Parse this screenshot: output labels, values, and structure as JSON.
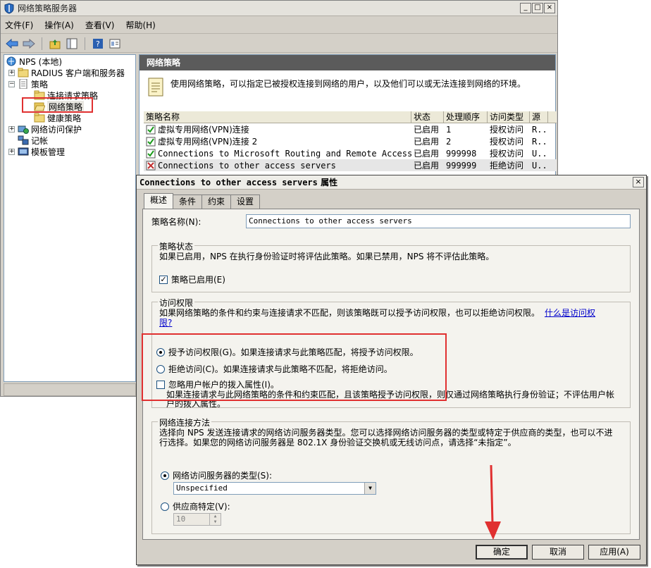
{
  "main_window": {
    "title": "网络策略服务器",
    "window_buttons": [
      "_",
      "□",
      "×"
    ],
    "menu": [
      "文件(F)",
      "操作(A)",
      "查看(V)",
      "帮助(H)"
    ]
  },
  "tree": {
    "items": [
      {
        "label": "NPS (本地)",
        "icon": "server-icon"
      },
      {
        "label": "RADIUS 客户端和服务器",
        "icon": "folder-icon",
        "expander": "+"
      },
      {
        "label": "策略",
        "icon": "document-icon",
        "expander": "−"
      },
      {
        "label": "连接请求策略",
        "icon": "folder-icon"
      },
      {
        "label": "网络策略",
        "icon": "folder-open-icon"
      },
      {
        "label": "健康策略",
        "icon": "folder-icon"
      },
      {
        "label": "网络访问保护",
        "icon": "nap-icon",
        "expander": "+"
      },
      {
        "label": "记帐",
        "icon": "accounting-icon"
      },
      {
        "label": "模板管理",
        "icon": "template-icon",
        "expander": "+"
      }
    ]
  },
  "right_pane": {
    "header": "网络策略",
    "description": "使用网络策略，可以指定已被授权连接到网络的用户，以及他们可以或无法连接到网络的环境。",
    "columns": [
      "策略名称",
      "状态",
      "处理顺序",
      "访问类型",
      "源"
    ],
    "rows": [
      {
        "name": "虚拟专用网络(VPN)连接",
        "state": "已启用",
        "order": "1",
        "type": "授权访问",
        "src": "R.."
      },
      {
        "name": "虚拟专用网络(VPN)连接 2",
        "state": "已启用",
        "order": "2",
        "type": "授权访问",
        "src": "R.."
      },
      {
        "name": "Connections to Microsoft Routing and Remote Access server",
        "state": "已启用",
        "order": "999998",
        "type": "授权访问",
        "src": "U.."
      },
      {
        "name": "Connections to other access servers",
        "state": "已启用",
        "order": "999999",
        "type": "拒绝访问",
        "src": "U.."
      }
    ]
  },
  "dialog": {
    "title_en": "Connections to other access servers",
    "title_cn": "属性",
    "close": "×",
    "tabs": [
      "概述",
      "条件",
      "约束",
      "设置"
    ],
    "policy_name_label": "策略名称(N):",
    "policy_name_value": "Connections to other access servers",
    "state_group": {
      "legend": "策略状态",
      "text": "如果已启用，NPS 在执行身份验证时将评估此策略。如果已禁用，NPS 将不评估此策略。",
      "enabled_label": "策略已启用(E)",
      "enabled_mark": "✓"
    },
    "access_group": {
      "legend": "访问权限",
      "text": "如果网络策略的条件和约束与连接请求不匹配，则该策略既可以授予访问权限，也可以拒绝访问权限。",
      "link_line1": "什么是访问权",
      "link_line2": "限?",
      "grant_label": "授予访问权限(G)。如果连接请求与此策略匹配，将授予访问权限。",
      "deny_label": "拒绝访问(C)。如果连接请求与此策略不匹配，将拒绝访问。",
      "ignore_label": "忽略用户帐户的拨入属性(I)。",
      "ignore_desc_line1": "如果连接请求与此网络策略的条件和约束匹配，且该策略授予访问权限，则仅通过网络策略执行身份验证；不评估用户帐",
      "ignore_desc_line2": "户的拨入属性。"
    },
    "conn_group": {
      "legend": "网络连接方法",
      "text_line1": "选择向 NPS 发送连接请求的网络访问服务器类型。您可以选择网络访问服务器的类型或特定于供应商的类型，也可以不进",
      "text_line2": "行选择。如果您的网络访问服务器是 802.1X 身份验证交换机或无线访问点，请选择“未指定”。",
      "type_label": "网络访问服务器的类型(S):",
      "type_value": "Unspecified",
      "vendor_label": "供应商特定(V):",
      "vendor_value": "10"
    },
    "buttons": {
      "ok": "确定",
      "cancel": "取消",
      "apply": "应用(A)"
    }
  },
  "annotation_color": "#e03030"
}
